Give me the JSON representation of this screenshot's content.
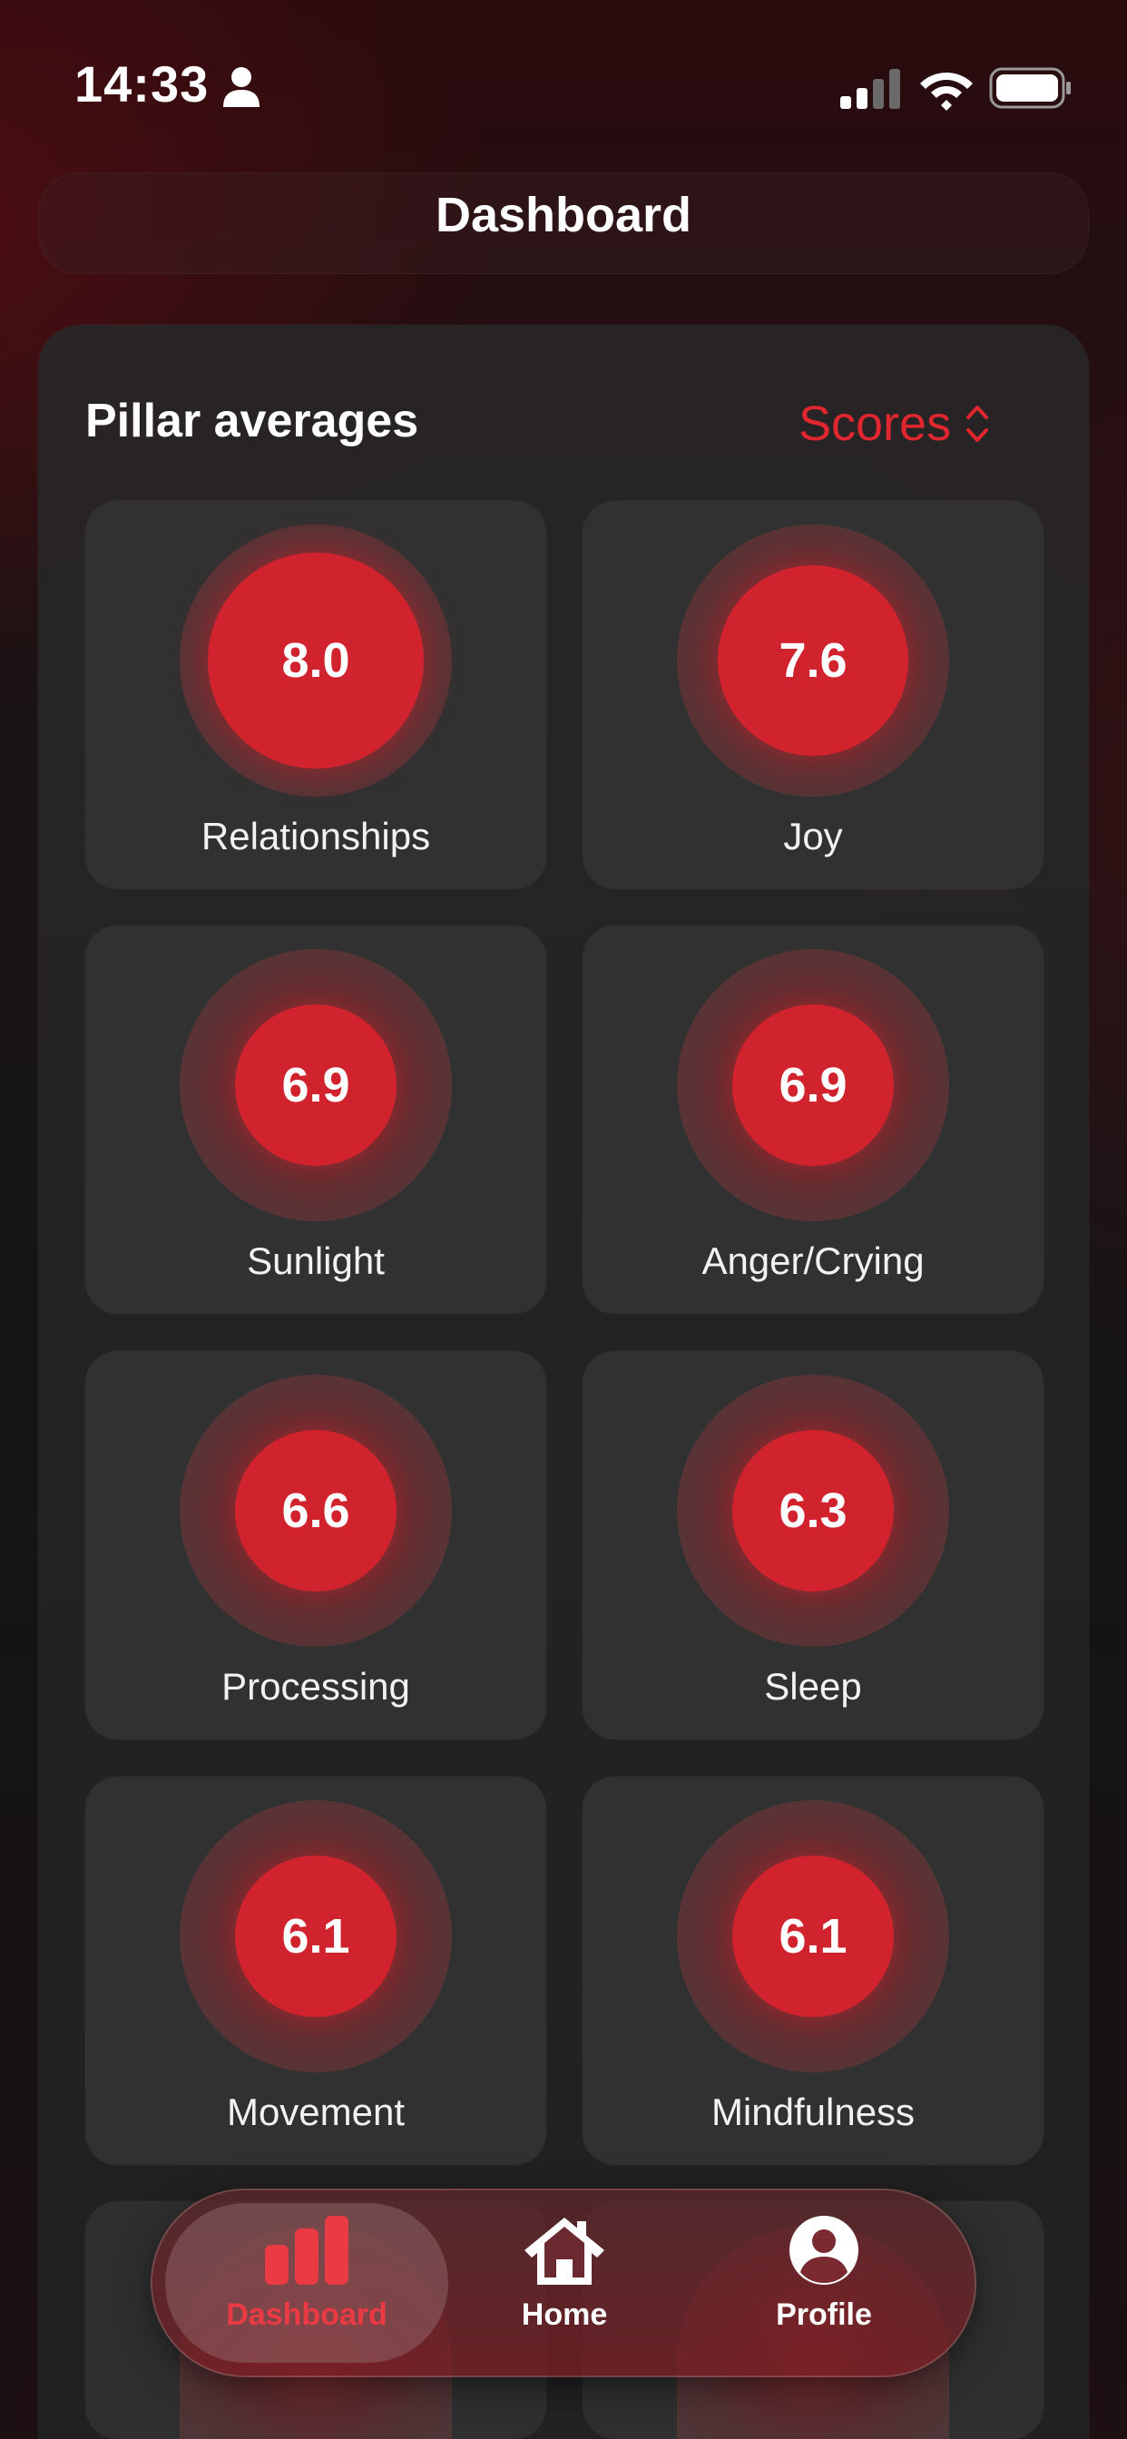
{
  "status_bar": {
    "time": "14:33",
    "icons": [
      "person-icon",
      "signal-icon",
      "wifi-icon",
      "battery-icon"
    ]
  },
  "header": {
    "title": "Dashboard"
  },
  "pillars": {
    "title": "Pillar averages",
    "selector_label": "Scores",
    "selector_icon": "chevron-up-down-icon",
    "items": [
      {
        "label": "Relationships",
        "score": "8.0"
      },
      {
        "label": "Joy",
        "score": "7.6"
      },
      {
        "label": "Sunlight",
        "score": "6.9"
      },
      {
        "label": "Anger/Crying",
        "score": "6.9"
      },
      {
        "label": "Processing",
        "score": "6.6"
      },
      {
        "label": "Sleep",
        "score": "6.3"
      },
      {
        "label": "Movement",
        "score": "6.1"
      },
      {
        "label": "Mindfulness",
        "score": "6.1"
      }
    ]
  },
  "nav": {
    "items": [
      {
        "label": "Dashboard",
        "icon": "bar-chart-icon",
        "active": true
      },
      {
        "label": "Home",
        "icon": "house-icon",
        "active": false
      },
      {
        "label": "Profile",
        "icon": "person-circle-icon",
        "active": false
      }
    ]
  },
  "colors": {
    "accent": "#d1232d",
    "accent_text": "#e0262f",
    "tile_bg": "#313131",
    "card_bg": "#262425"
  }
}
